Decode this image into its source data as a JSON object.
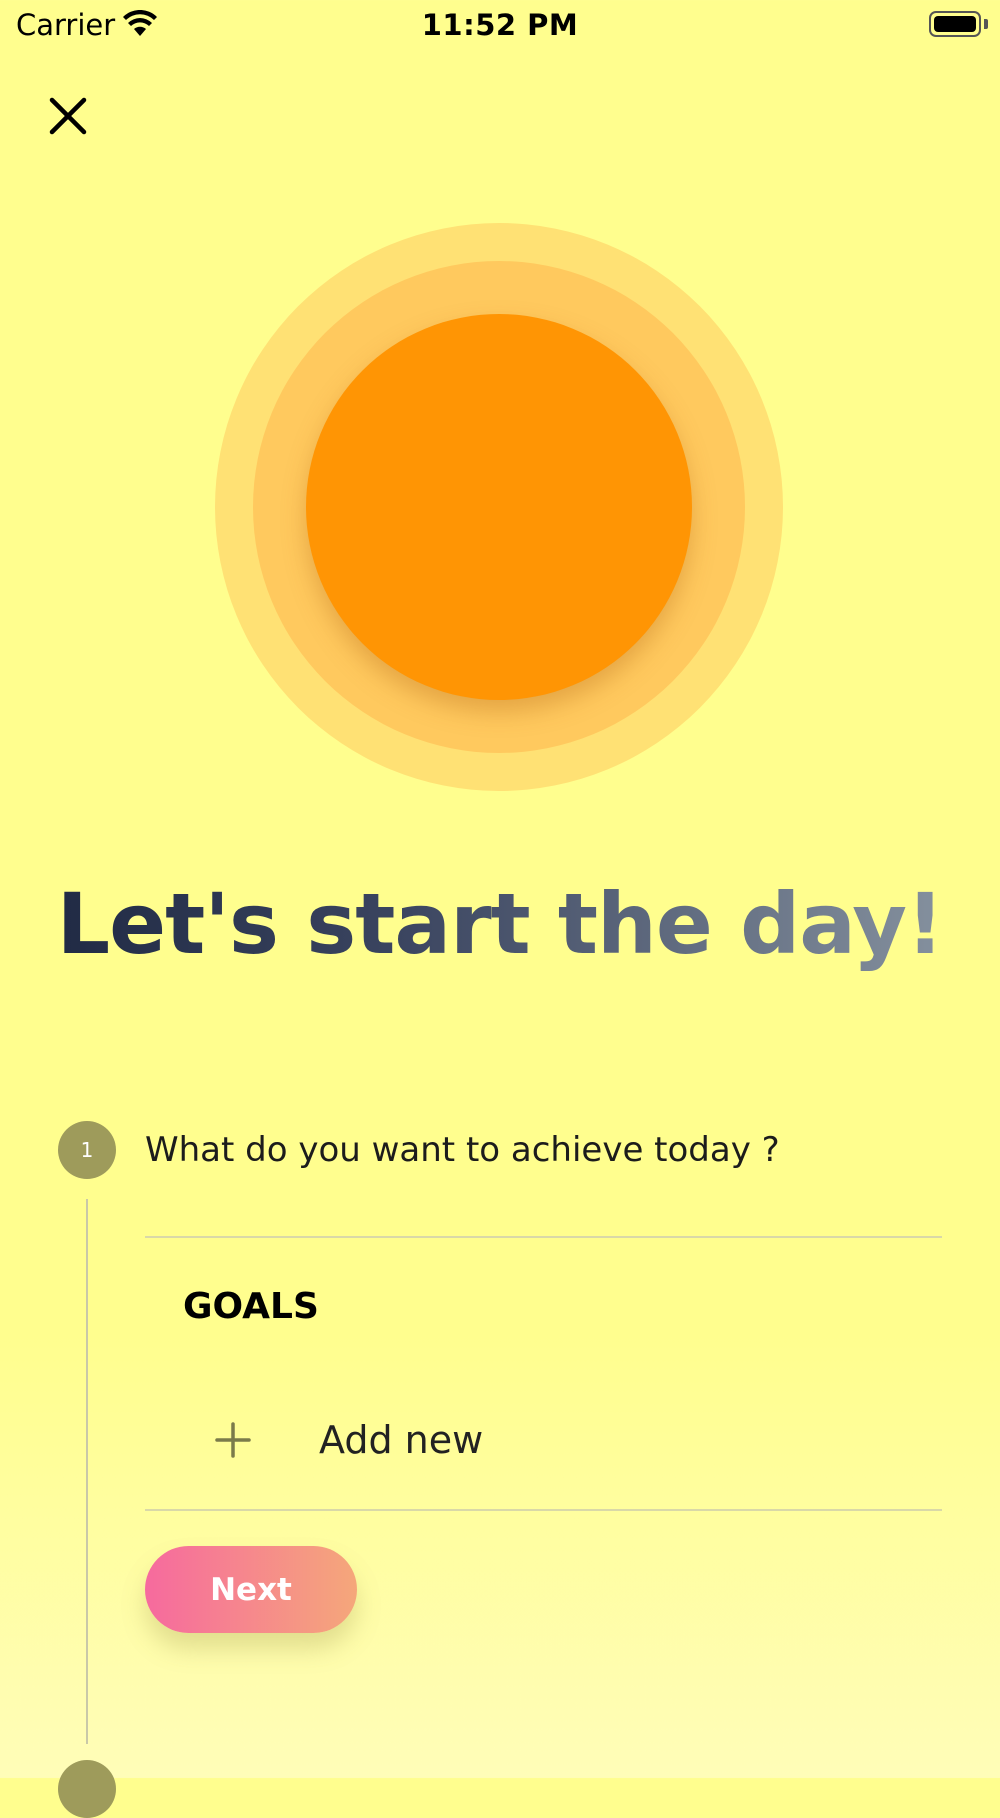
{
  "status_bar": {
    "carrier": "Carrier",
    "time": "11:52 PM"
  },
  "header": {
    "close_icon": "close-icon"
  },
  "hero": {
    "headline": "Let's start the day!",
    "sun_colors": {
      "outer": "#ffe174",
      "middle": "#ffc95e",
      "core": "#ff9504"
    }
  },
  "steps": [
    {
      "number": "1",
      "question": "What do you want to achieve today ?",
      "section_title": "GOALS",
      "add_label": "Add new",
      "next_label": "Next"
    }
  ],
  "colors": {
    "background": "#fffe8e",
    "step_circle": "#9e9b5b",
    "button_gradient": [
      "#f66a9e",
      "#f5a77a"
    ]
  }
}
